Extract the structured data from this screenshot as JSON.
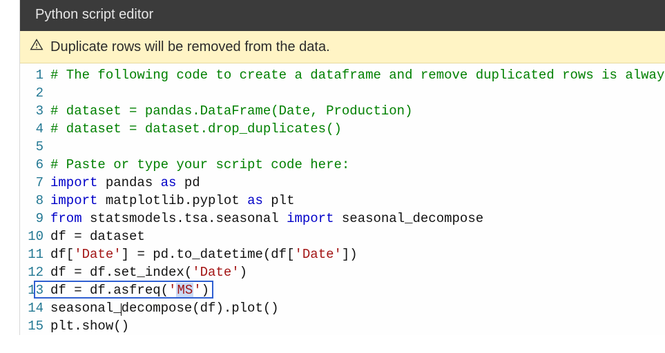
{
  "header": {
    "title": "Python script editor"
  },
  "warning": {
    "icon": "warning-triangle-icon",
    "text": "Duplicate rows will be removed from the data."
  },
  "code": {
    "highlight_line": 13,
    "lines": [
      {
        "n": 1,
        "seg": [
          {
            "t": "# The following code to create a dataframe and remove duplicated rows is always",
            "c": "comment"
          }
        ]
      },
      {
        "n": 2,
        "seg": [
          {
            "t": "",
            "c": "plain"
          }
        ]
      },
      {
        "n": 3,
        "seg": [
          {
            "t": "# dataset = pandas.DataFrame(Date, Production)",
            "c": "comment"
          }
        ]
      },
      {
        "n": 4,
        "seg": [
          {
            "t": "# dataset = dataset.drop_duplicates()",
            "c": "comment"
          }
        ]
      },
      {
        "n": 5,
        "seg": [
          {
            "t": "",
            "c": "plain"
          }
        ]
      },
      {
        "n": 6,
        "seg": [
          {
            "t": "# Paste or type your script code here:",
            "c": "comment"
          }
        ]
      },
      {
        "n": 7,
        "seg": [
          {
            "t": "import",
            "c": "keyword"
          },
          {
            "t": " pandas ",
            "c": "plain"
          },
          {
            "t": "as",
            "c": "keyword"
          },
          {
            "t": " pd",
            "c": "plain"
          }
        ]
      },
      {
        "n": 8,
        "seg": [
          {
            "t": "import",
            "c": "keyword"
          },
          {
            "t": " matplotlib.pyplot ",
            "c": "plain"
          },
          {
            "t": "as",
            "c": "keyword"
          },
          {
            "t": " plt",
            "c": "plain"
          }
        ]
      },
      {
        "n": 9,
        "seg": [
          {
            "t": "from",
            "c": "keyword"
          },
          {
            "t": " statsmodels.tsa.seasonal ",
            "c": "plain"
          },
          {
            "t": "import",
            "c": "keyword"
          },
          {
            "t": " seasonal_decompose",
            "c": "plain"
          }
        ]
      },
      {
        "n": 10,
        "seg": [
          {
            "t": "df = dataset",
            "c": "plain"
          }
        ]
      },
      {
        "n": 11,
        "seg": [
          {
            "t": "df[",
            "c": "plain"
          },
          {
            "t": "'Date'",
            "c": "string"
          },
          {
            "t": "] = pd.to_datetime(df[",
            "c": "plain"
          },
          {
            "t": "'Date'",
            "c": "string"
          },
          {
            "t": "])",
            "c": "plain"
          }
        ]
      },
      {
        "n": 12,
        "seg": [
          {
            "t": "df = df.set_index(",
            "c": "plain"
          },
          {
            "t": "'Date'",
            "c": "string"
          },
          {
            "t": ")",
            "c": "plain"
          }
        ]
      },
      {
        "n": 13,
        "seg": [
          {
            "t": "df = df.asfreq(",
            "c": "plain"
          },
          {
            "t": "'",
            "c": "string"
          },
          {
            "t": "MS",
            "c": "string",
            "sel": true
          },
          {
            "t": "'",
            "c": "string"
          },
          {
            "t": ")",
            "c": "plain"
          }
        ]
      },
      {
        "n": 14,
        "seg": [
          {
            "t": "seasonal_",
            "c": "plain"
          },
          {
            "t": "",
            "c": "caret"
          },
          {
            "t": "decompose(df).plot()",
            "c": "plain"
          }
        ]
      },
      {
        "n": 15,
        "seg": [
          {
            "t": "plt.show()",
            "c": "plain"
          }
        ]
      }
    ]
  }
}
